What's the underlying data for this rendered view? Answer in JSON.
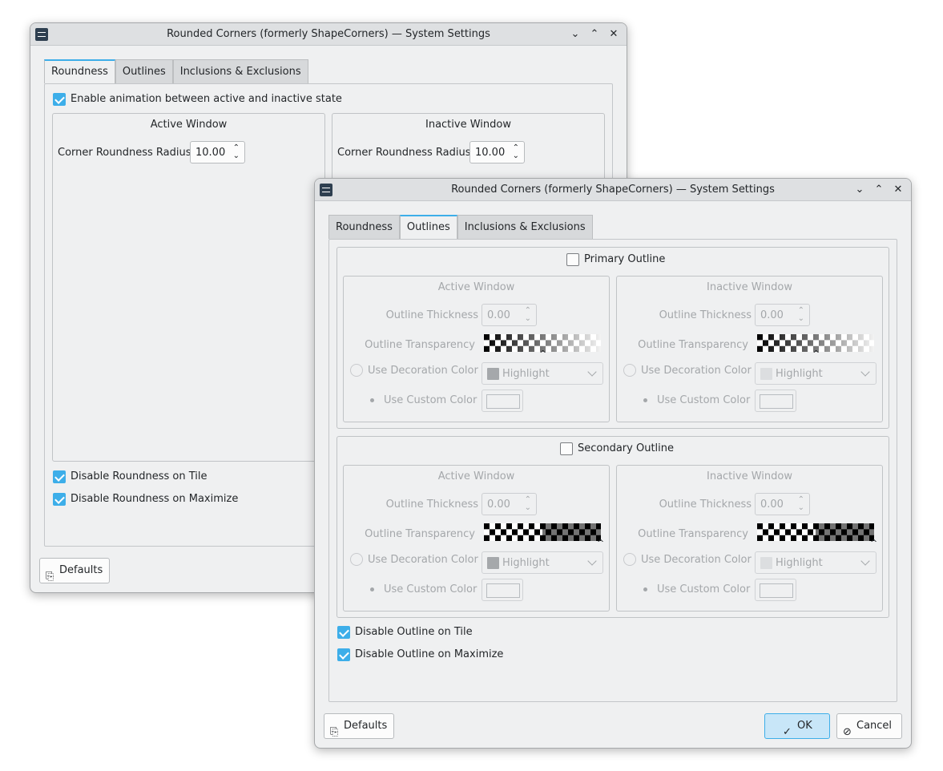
{
  "window_title": "Rounded Corners (formerly ShapeCorners) — System Settings",
  "titlebar_buttons": {
    "minimize": "⌄",
    "maximize": "⌃",
    "close": "✕"
  },
  "tabs": [
    "Roundness",
    "Outlines",
    "Inclusions & Exclusions"
  ],
  "back": {
    "active_tab": "Roundness",
    "enable_animation": "Enable animation between active and inactive state",
    "active_group": "Active Window",
    "inactive_group": "Inactive Window",
    "radius_label": "Corner Roundness Radius",
    "active_radius": "10.00",
    "inactive_radius": "10.00",
    "disable_tile": "Disable Roundness on Tile",
    "disable_maximize": "Disable Roundness on Maximize",
    "defaults": "Defaults"
  },
  "front": {
    "active_tab": "Outlines",
    "primary_outline": "Primary Outline",
    "secondary_outline": "Secondary Outline",
    "active_group": "Active Window",
    "inactive_group": "Inactive Window",
    "thickness_label": "Outline Thickness",
    "thickness_value": "0.00",
    "transparency_label": "Outline Transparency",
    "decoration_label": "Use Decoration Color",
    "custom_label": "Use Custom Color",
    "highlight": "Highlight",
    "disable_tile": "Disable Outline on Tile",
    "disable_maximize": "Disable Outline on Maximize",
    "defaults": "Defaults",
    "ok": "OK",
    "cancel": "Cancel"
  },
  "colors": {
    "accent": "#3daee9",
    "window_bg": "#eff0f1",
    "disabled_text": "#a4a7aa"
  },
  "icons": {
    "app": "settings-app-icon",
    "defaults": "document-revert-icon",
    "ok": "checkmark-icon",
    "cancel": "cancel-icon"
  }
}
